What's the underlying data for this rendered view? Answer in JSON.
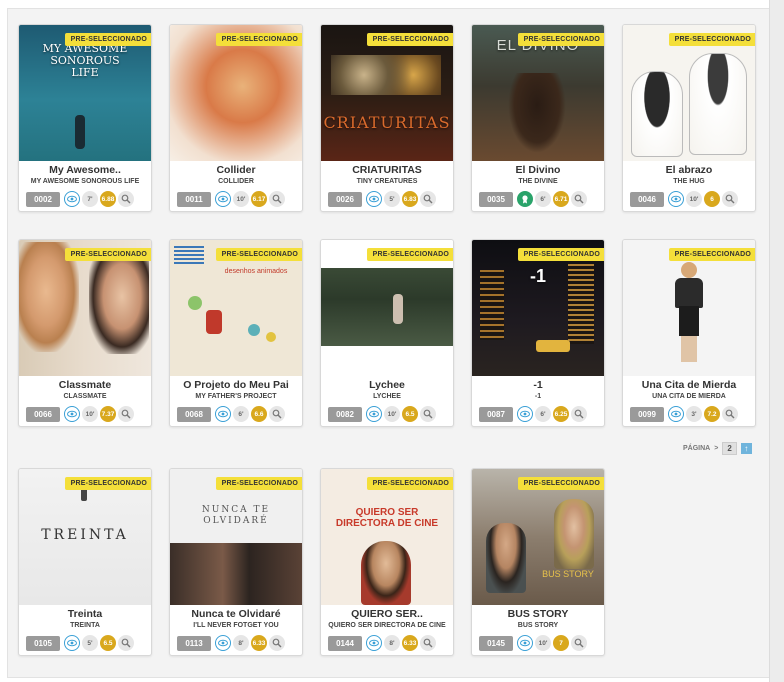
{
  "badge_label": "PRE-SELECCIONADO",
  "colors": {
    "badge": "#f4df3a",
    "score": "#d9a81d",
    "eye": "#3aa0d6",
    "id": "#9a9a9a"
  },
  "films": [
    {
      "id": "0002",
      "title": "My Awesome..",
      "subtitle": "MY AWESOME SONOROUS LIFE",
      "duration": "7'",
      "score": "6.88",
      "eye_icon": "eye-icon",
      "poster_text": "MY AWESOME SONOROUS LIFE"
    },
    {
      "id": "0011",
      "title": "Collider",
      "subtitle": "COLLIDER",
      "duration": "10'",
      "score": "6.17",
      "eye_icon": "eye-icon",
      "poster_text": ""
    },
    {
      "id": "0026",
      "title": "CRIATURITAS",
      "subtitle": "TINY CREATURES",
      "duration": "5'",
      "score": "6.83",
      "eye_icon": "eye-icon",
      "poster_text": "CRIATURITAS"
    },
    {
      "id": "0035",
      "title": "El Divino",
      "subtitle": "THE DIVINE",
      "duration": "6'",
      "score": "6.71",
      "eye_icon": "award-icon",
      "poster_text": "EL DIVINO"
    },
    {
      "id": "0046",
      "title": "El abrazo",
      "subtitle": "THE HUG",
      "duration": "10'",
      "score": "6",
      "eye_icon": "eye-icon",
      "poster_text": ""
    },
    {
      "id": "0066",
      "title": "Classmate",
      "subtitle": "CLASSMATE",
      "duration": "10'",
      "score": "7.37",
      "eye_icon": "eye-icon",
      "poster_text": ""
    },
    {
      "id": "0068",
      "title": "O Projeto do Meu Pai",
      "subtitle": "MY FATHER'S PROJECT",
      "duration": "6'",
      "score": "6.6",
      "eye_icon": "eye-icon",
      "poster_text": "desenhos animados"
    },
    {
      "id": "0082",
      "title": "Lychee",
      "subtitle": "LYCHEE",
      "duration": "10'",
      "score": "6.5",
      "eye_icon": "eye-icon",
      "poster_text": ""
    },
    {
      "id": "0087",
      "title": "-1",
      "subtitle": "-1",
      "duration": "6'",
      "score": "6.25",
      "eye_icon": "eye-icon",
      "poster_text": "-1"
    },
    {
      "id": "0099",
      "title": "Una Cita de Mierda",
      "subtitle": "UNA CITA DE MIERDA",
      "duration": "3'",
      "score": "7.2",
      "eye_icon": "eye-icon",
      "poster_text": ""
    },
    {
      "id": "0105",
      "title": "Treinta",
      "subtitle": "TREINTA",
      "duration": "5'",
      "score": "6.5",
      "eye_icon": "eye-icon",
      "poster_text": "TREINTA"
    },
    {
      "id": "0113",
      "title": "Nunca te Olvidaré",
      "subtitle": "I'LL NEVER FOTGET YOU",
      "duration": "8'",
      "score": "6.33",
      "eye_icon": "eye-icon",
      "poster_text": "NUNCA TE OLVIDARÉ"
    },
    {
      "id": "0144",
      "title": "QUIERO SER..",
      "subtitle": "QUIERO SER DIRECTORA DE CINE",
      "duration": "8'",
      "score": "6.33",
      "eye_icon": "eye-icon",
      "poster_text": "QUIERO SER DIRECTORA DE CINE"
    },
    {
      "id": "0145",
      "title": "BUS STORY",
      "subtitle": "BUS STORY",
      "duration": "10'",
      "score": "7",
      "eye_icon": "eye-icon",
      "poster_text": "BUS STORY"
    }
  ],
  "pager": {
    "label": "PÁGINA",
    "separator": ">",
    "page": "2",
    "next_icon": "next-page-icon"
  }
}
